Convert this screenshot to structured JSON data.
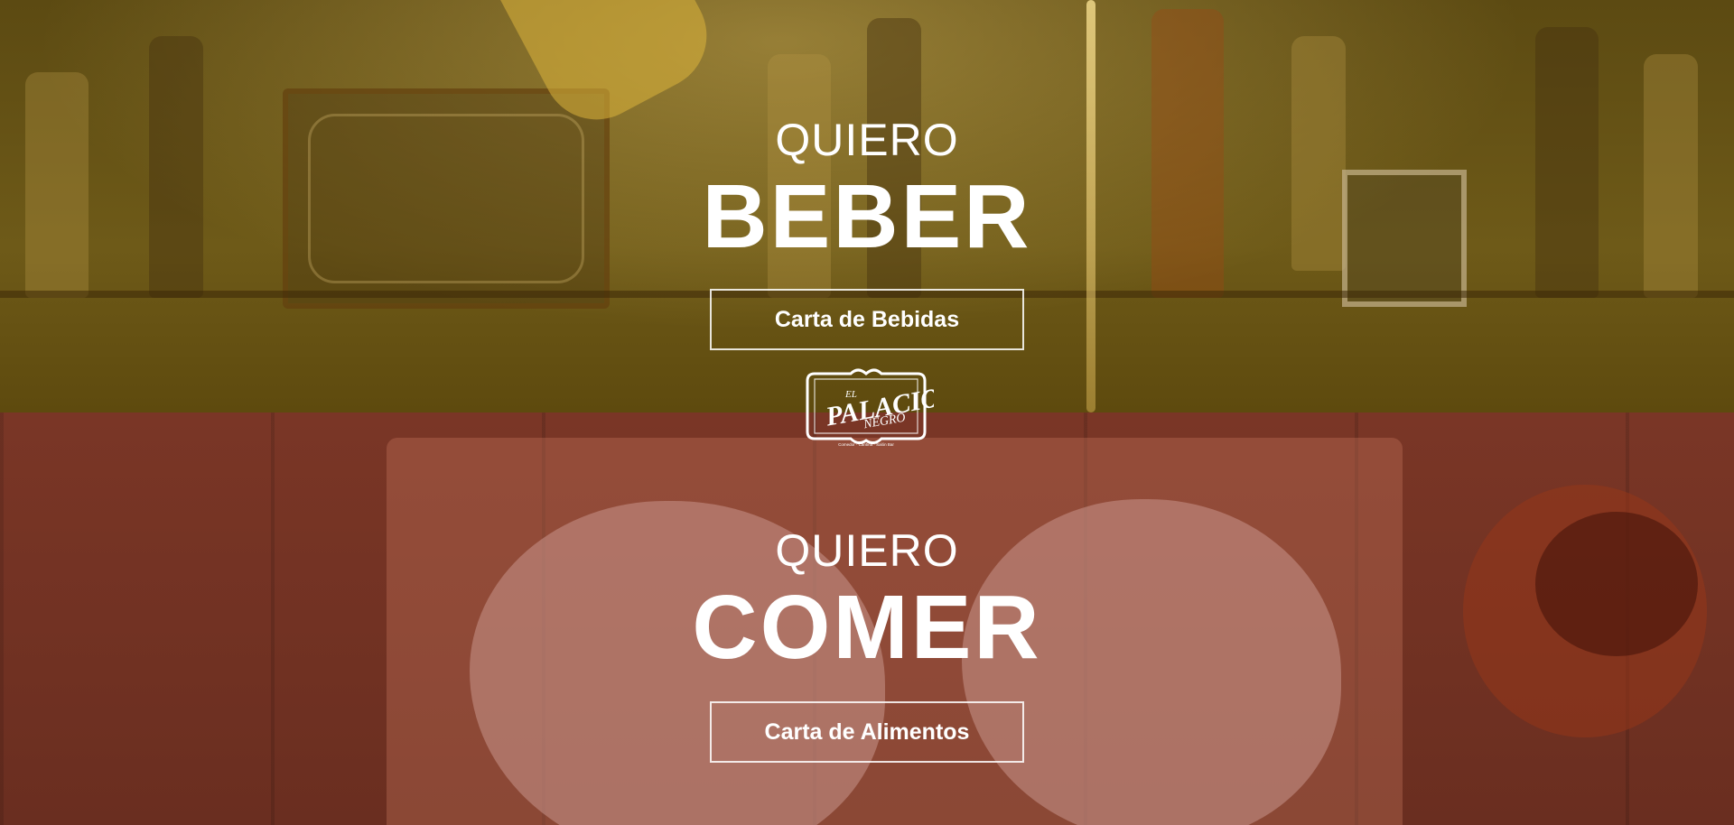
{
  "drink": {
    "kicker": "QUIERO",
    "headline": "BEBER",
    "button_label": "Carta de Bebidas"
  },
  "food": {
    "kicker": "QUIERO",
    "headline": "COMER",
    "button_label": "Carta de Alimentos"
  },
  "logo": {
    "line1": "EL",
    "line2": "PALACIO",
    "line3": "NEGRO",
    "tagline": "Comedor · Cantina · Salón Bar"
  },
  "colors": {
    "drink_overlay": "#6b5614",
    "food_overlay": "#7a3322",
    "text": "#ffffff"
  }
}
